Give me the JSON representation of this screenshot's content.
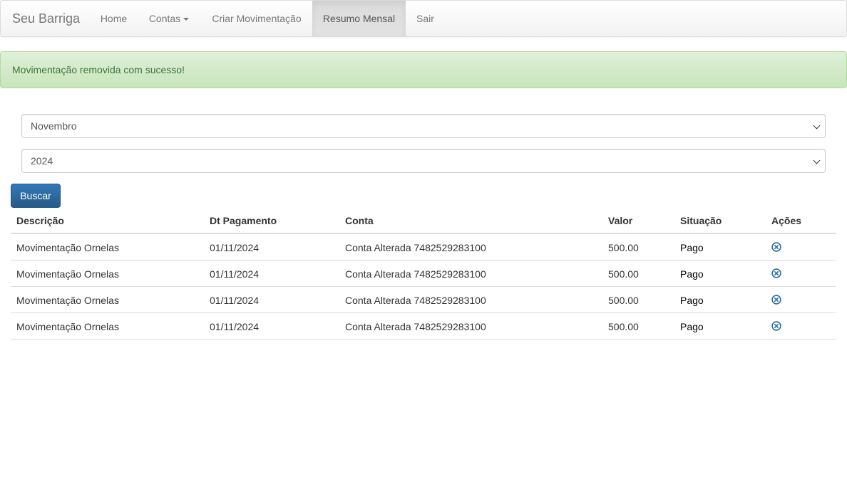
{
  "navbar": {
    "brand": "Seu Barriga",
    "items": [
      {
        "label": "Home"
      },
      {
        "label": "Contas"
      },
      {
        "label": "Criar Movimentação"
      },
      {
        "label": "Resumo Mensal"
      },
      {
        "label": "Sair"
      }
    ],
    "active": "Resumo Mensal"
  },
  "alert": {
    "message": "Movimentação removida com sucesso!"
  },
  "filters": {
    "month": "Novembro",
    "year": "2024",
    "search_label": "Buscar"
  },
  "table": {
    "headers": [
      "Descrição",
      "Dt Pagamento",
      "Conta",
      "Valor",
      "Situação",
      "Ações"
    ],
    "rows": [
      {
        "descricao": "Movimentação Ornelas",
        "data": "01/11/2024",
        "conta": "Conta Alterada 7482529283100",
        "valor": "500.00",
        "situacao": "Pago",
        "acao_icon": "remove-circle-icon"
      },
      {
        "descricao": "Movimentação Ornelas",
        "data": "01/11/2024",
        "conta": "Conta Alterada 7482529283100",
        "valor": "500.00",
        "situacao": "Pago",
        "acao_icon": "remove-circle-icon"
      },
      {
        "descricao": "Movimentação Ornelas",
        "data": "01/11/2024",
        "conta": "Conta Alterada 7482529283100",
        "valor": "500.00",
        "situacao": "Pago",
        "acao_icon": "remove-circle-icon"
      },
      {
        "descricao": "Movimentação Ornelas",
        "data": "01/11/2024",
        "conta": "Conta Alterada 7482529283100",
        "valor": "500.00",
        "situacao": "Pago",
        "acao_icon": "remove-circle-icon"
      }
    ]
  },
  "colors": {
    "primary": "#337ab7",
    "success_bg": "#dff0d8",
    "success_text": "#3c763d",
    "icon": "#2e6da4"
  }
}
